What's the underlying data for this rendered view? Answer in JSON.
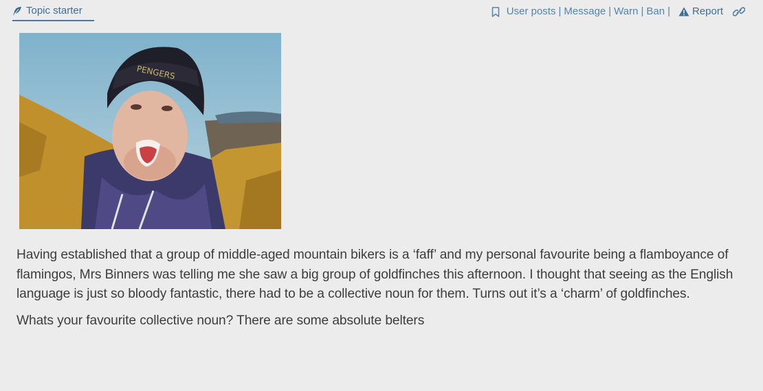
{
  "header": {
    "topic_starter_label": "Topic starter",
    "actions": {
      "user_posts": "User posts",
      "message": "Message",
      "warn": "Warn",
      "ban": "Ban",
      "report": "Report",
      "separator": "|"
    }
  },
  "post": {
    "image_icon": "gif-image",
    "paragraphs": [
      "Having established that a group of middle-aged mountain bikers is a ‘faff’ and my personal favourite being a flamboyance of flamingos, Mrs Binners was telling me she saw a big group of goldfinches this afternoon. I thought that seeing as the English language is just so bloody fantastic, there had to be a collective noun for them. Turns out it’s a ‘charm’ of goldfinches.",
      "Whats your favourite collective noun?  There are some absolute belters"
    ]
  },
  "colors": {
    "background": "#ececec",
    "link": "#5584a8",
    "accent": "#3c6f98",
    "text": "#3d3d3d"
  }
}
